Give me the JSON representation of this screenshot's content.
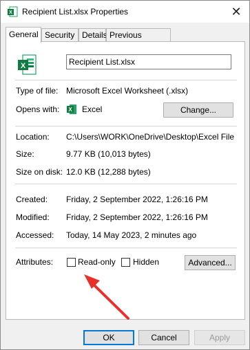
{
  "window": {
    "title": "Recipient List.xlsx Properties",
    "close_glyph": "✕"
  },
  "tabs": [
    {
      "label": "General",
      "active": true
    },
    {
      "label": "Security",
      "active": false
    },
    {
      "label": "Details",
      "active": false
    },
    {
      "label": "Previous Versions",
      "active": false
    }
  ],
  "general": {
    "file_name": "Recipient List.xlsx",
    "type_label": "Type of file:",
    "type_value": "Microsoft Excel Worksheet (.xlsx)",
    "opens_label": "Opens with:",
    "opens_value": "Excel",
    "change_button": "Change...",
    "location_label": "Location:",
    "location_value": "C:\\Users\\WORK\\OneDrive\\Desktop\\Excel File",
    "size_label": "Size:",
    "size_value": "9.77 KB (10,013 bytes)",
    "size_disk_label": "Size on disk:",
    "size_disk_value": "12.0 KB (12,288 bytes)",
    "created_label": "Created:",
    "created_value": "Friday, 2 September 2022, 1:26:16 PM",
    "modified_label": "Modified:",
    "modified_value": "Friday, 2 September 2022, 1:26:16 PM",
    "accessed_label": "Accessed:",
    "accessed_value": "Today, 14 May 2023, 2 minutes ago",
    "attributes_label": "Attributes:",
    "readonly_label": "Read-only",
    "readonly_checked": false,
    "hidden_label": "Hidden",
    "hidden_checked": false,
    "advanced_button": "Advanced..."
  },
  "footer": {
    "ok": "OK",
    "cancel": "Cancel",
    "apply": "Apply"
  },
  "colors": {
    "excel_green": "#107c41",
    "accent_blue": "#0078d7",
    "annotation_red": "#e8312a"
  },
  "icons": {
    "title": "excel-file-icon",
    "close": "close-icon",
    "file": "excel-file-icon",
    "app": "excel-app-icon",
    "annotation": "red-arrow-icon"
  }
}
